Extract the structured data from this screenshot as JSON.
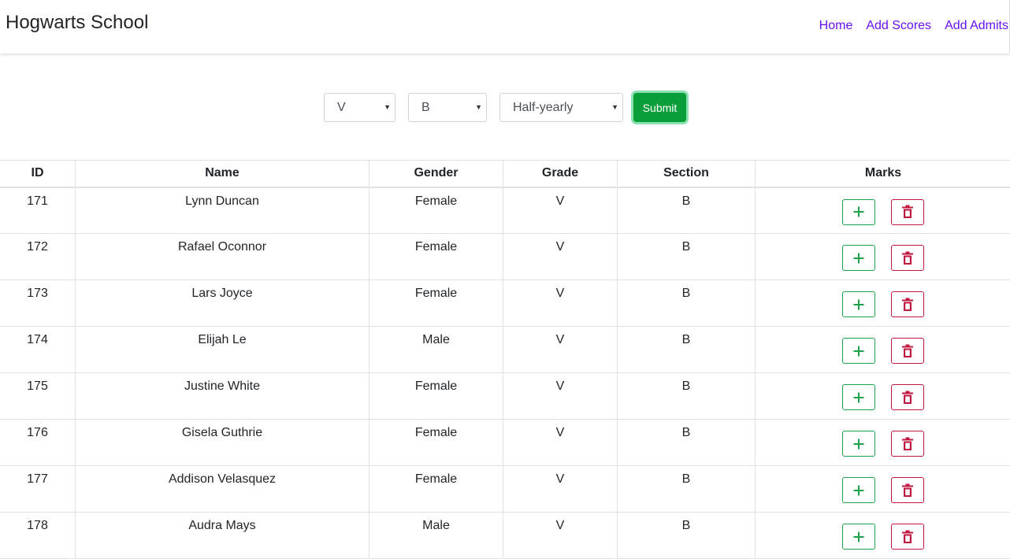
{
  "nav": {
    "brand": "Hogwarts School",
    "links": [
      "Home",
      "Add Scores",
      "Add Admits"
    ]
  },
  "filters": {
    "grade": "V",
    "section": "B",
    "term": "Half-yearly",
    "submit_label": "Submit"
  },
  "table": {
    "headers": [
      "ID",
      "Name",
      "Gender",
      "Grade",
      "Section",
      "Marks"
    ],
    "rows": [
      {
        "id": "171",
        "name": "Lynn Duncan",
        "gender": "Female",
        "grade": "V",
        "section": "B"
      },
      {
        "id": "172",
        "name": "Rafael Oconnor",
        "gender": "Female",
        "grade": "V",
        "section": "B"
      },
      {
        "id": "173",
        "name": "Lars Joyce",
        "gender": "Female",
        "grade": "V",
        "section": "B"
      },
      {
        "id": "174",
        "name": "Elijah Le",
        "gender": "Male",
        "grade": "V",
        "section": "B"
      },
      {
        "id": "175",
        "name": "Justine White",
        "gender": "Female",
        "grade": "V",
        "section": "B"
      },
      {
        "id": "176",
        "name": "Gisela Guthrie",
        "gender": "Female",
        "grade": "V",
        "section": "B"
      },
      {
        "id": "177",
        "name": "Addison Velasquez",
        "gender": "Female",
        "grade": "V",
        "section": "B"
      },
      {
        "id": "178",
        "name": "Audra Mays",
        "gender": "Male",
        "grade": "V",
        "section": "B"
      }
    ]
  },
  "icons": {
    "add": "plus-icon",
    "delete": "trash-icon"
  },
  "colors": {
    "link": "#6610f2",
    "submit": "#0a9e3a",
    "add": "#1aa34a",
    "delete": "#c0173f"
  }
}
